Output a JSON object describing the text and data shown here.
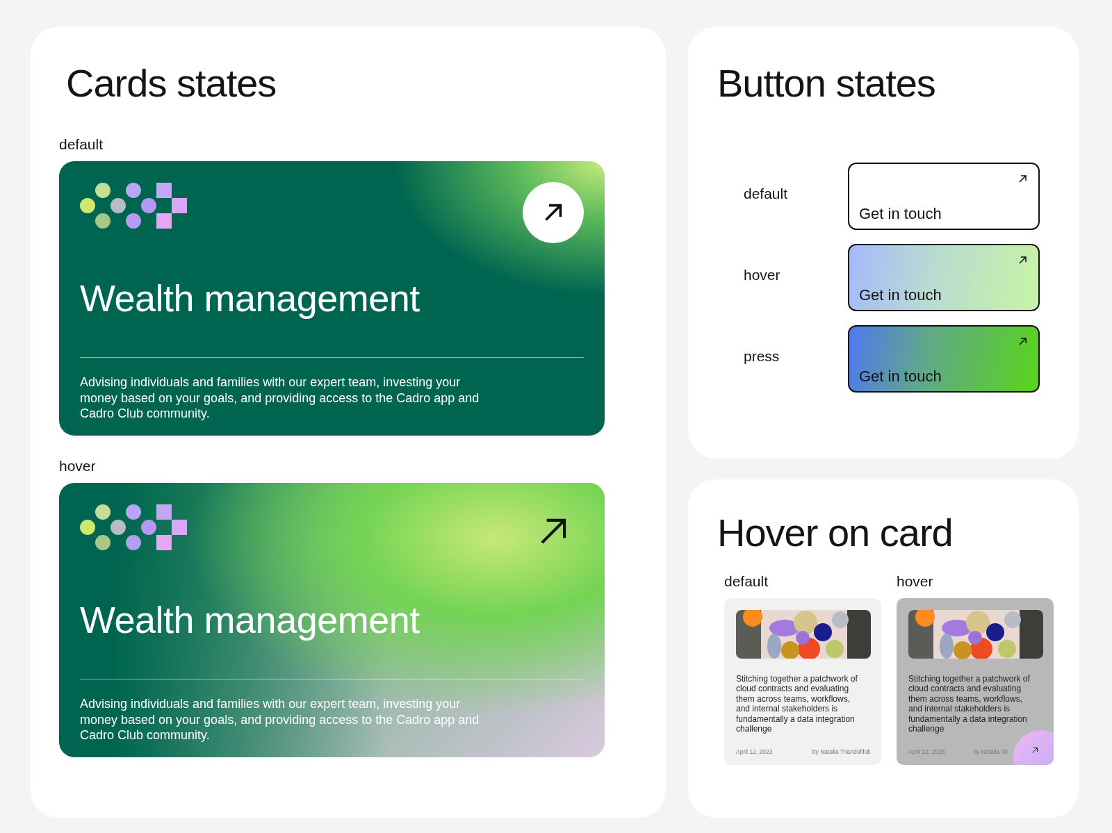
{
  "cards_panel": {
    "title": "Cards states",
    "cards": [
      {
        "kind": "default",
        "label": "default",
        "title": "Wealth management",
        "description": "Advising individuals and families with our expert team, investing your money based on your goals, and providing access to the Cadro app and Cadro Club community."
      },
      {
        "kind": "hover",
        "label": "hover",
        "title": "Wealth management",
        "description": "Advising individuals and families with our expert team, investing your money based on your goals, and providing access to the Cadro app and Cadro Club community."
      }
    ]
  },
  "button_panel": {
    "title": "Button states",
    "rows": [
      {
        "kind": "default",
        "label": "default",
        "button": "Get in touch"
      },
      {
        "kind": "hover",
        "label": "hover",
        "button": "Get in touch"
      },
      {
        "kind": "press",
        "label": "press",
        "button": "Get in touch"
      }
    ]
  },
  "hover_panel": {
    "title": "Hover on card",
    "columns": [
      {
        "kind": "default",
        "label": "default",
        "text": "Stitching together a patchwork of cloud contracts and evaluating them across teams, workflows, and internal stakeholders is fundamentally a data integration challenge",
        "date": "April 12, 2023",
        "author": "by Natalia Triandofilidi"
      },
      {
        "kind": "hover",
        "label": "hover",
        "text": "Stitching together a patchwork of cloud contracts and evaluating them across teams, workflows, and internal stakeholders is fundamentally a data integration challenge",
        "date": "April 12, 2023",
        "author": "by Natalia Tri"
      }
    ]
  }
}
